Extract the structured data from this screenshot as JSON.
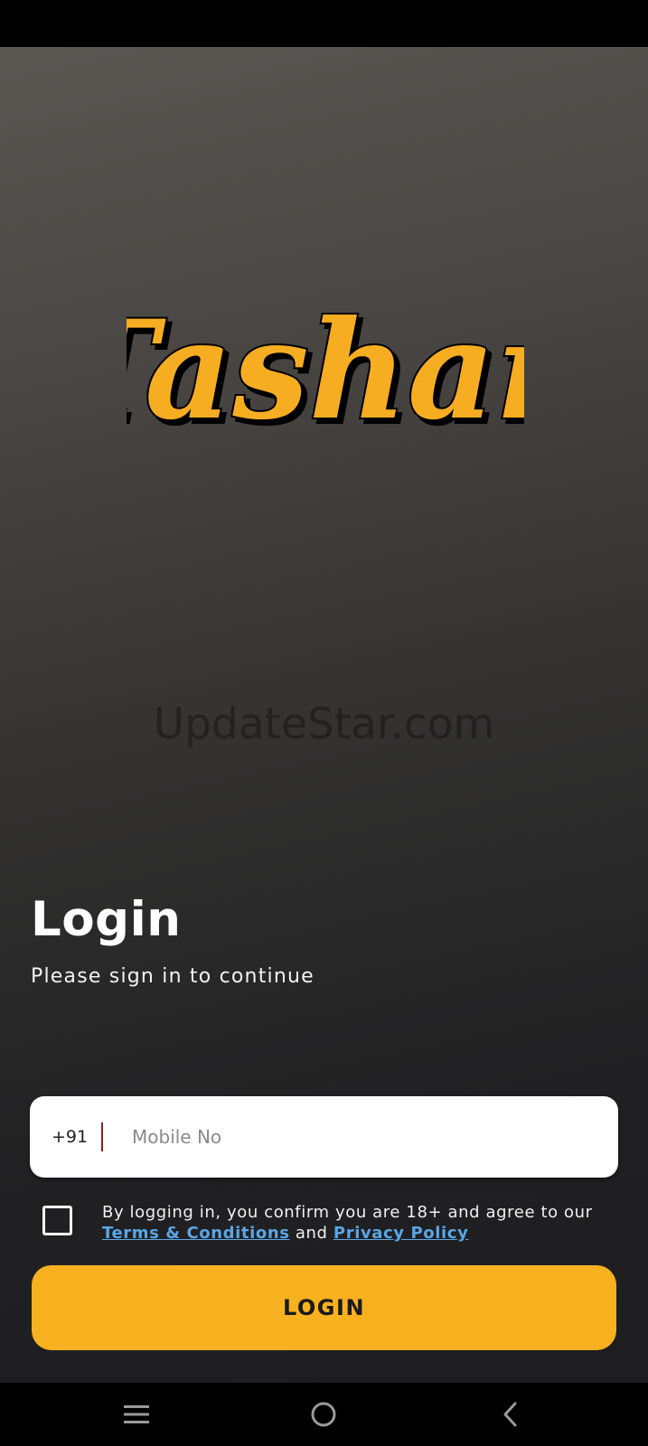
{
  "app": {
    "logo_text": "Tashan",
    "watermark": "UpdateStar.com"
  },
  "login": {
    "title": "Login",
    "subtitle": "Please sign in to continue",
    "country_code": "+91",
    "mobile_placeholder": "Mobile No",
    "mobile_value": "",
    "agree_prefix": "By logging in, you confirm you are 18+ and agree to our",
    "terms_link": "Terms & Conditions",
    "agree_and": "and",
    "privacy_link": "Privacy Policy",
    "checkbox_checked": false,
    "button_label": "LOGIN"
  },
  "navigation": {
    "icons": [
      "menu-icon",
      "home-icon",
      "back-icon"
    ]
  },
  "colors": {
    "accent": "#f8b11f",
    "link": "#5aa6e6",
    "logo_fill": "#f7ad22"
  }
}
